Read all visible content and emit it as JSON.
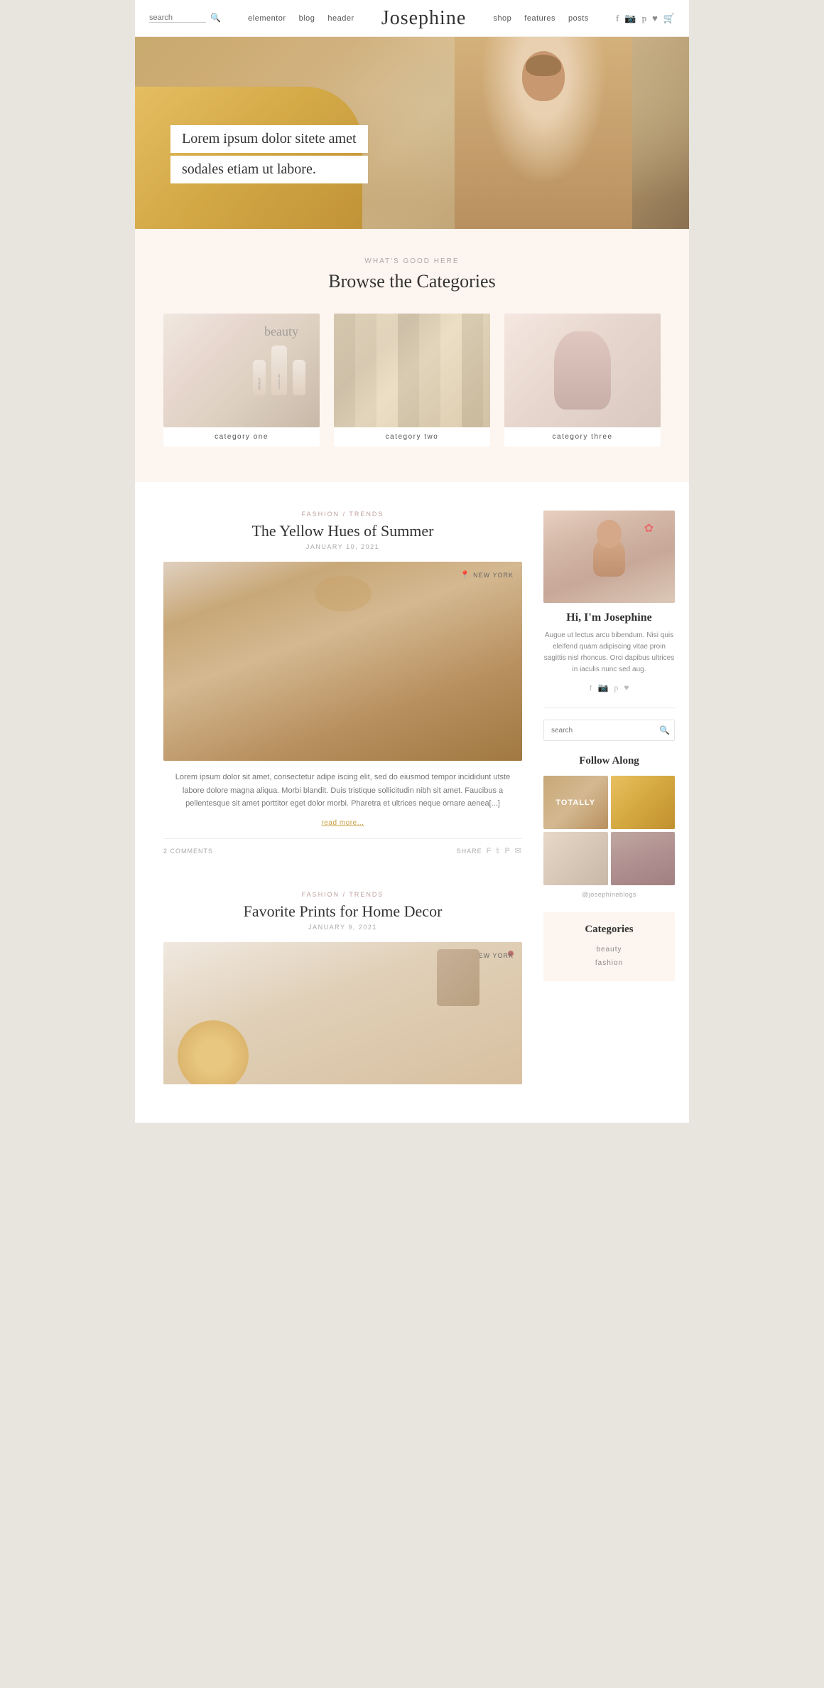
{
  "header": {
    "search_placeholder": "search",
    "nav": [
      {
        "label": "elementor",
        "href": "#"
      },
      {
        "label": "blog",
        "href": "#"
      },
      {
        "label": "header",
        "href": "#"
      },
      {
        "label": "shop",
        "href": "#"
      },
      {
        "label": "features",
        "href": "#"
      },
      {
        "label": "posts",
        "href": "#"
      }
    ],
    "logo": "Josephine",
    "social_icons": [
      "f",
      "i",
      "p",
      "♥",
      "0"
    ]
  },
  "hero": {
    "text_line1": "Lorem ipsum dolor sitete amet",
    "text_line2": "sodales etiam ut labore."
  },
  "categories_section": {
    "eyebrow": "WHAT'S GOOD HERE",
    "title": "Browse the Categories",
    "items": [
      {
        "label": "category one"
      },
      {
        "label": "category two"
      },
      {
        "label": "category three"
      }
    ]
  },
  "posts": [
    {
      "eyebrow": "FASHION / TRENDS",
      "title": "The Yellow Hues of Summer",
      "date": "JANUARY 10, 2021",
      "location": "NEW YORK",
      "excerpt": "Lorem ipsum dolor sit amet, consectetur adipe iscing elit, sed do eiusmod tempor incididunt utste labore dolore magna aliqua. Morbi blandit. Duis tristique sollicitudin nibh sit amet. Faucibus a pellentesque sit amet porttitor eget dolor morbi. Pharetra et ultrices neque ornare aenea[...]",
      "read_more": "read more...",
      "comments": "2 COMMENTS",
      "share_label": "SHARE"
    },
    {
      "eyebrow": "FASHION / TRENDS",
      "title": "Favorite Prints for Home Decor",
      "date": "JANUARY 9, 2021",
      "location": "NEW YORK"
    }
  ],
  "sidebar": {
    "author_name": "Hi, I'm Josephine",
    "author_bio": "Augue ut lectus arcu bibendum. Nisi quis eleifend quam adipiscing vitae proin sagittis nisl rhoncus. Orci dapibus ultrices in iaculis nunc sed aug.",
    "search_placeholder": "search",
    "follow_title": "Follow Along",
    "follow_handle": "@josephineblogs",
    "follow_img1_text": "TOTALLY",
    "categories_title": "Categories",
    "categories": [
      {
        "label": "beauty"
      },
      {
        "label": "fashion"
      }
    ]
  }
}
